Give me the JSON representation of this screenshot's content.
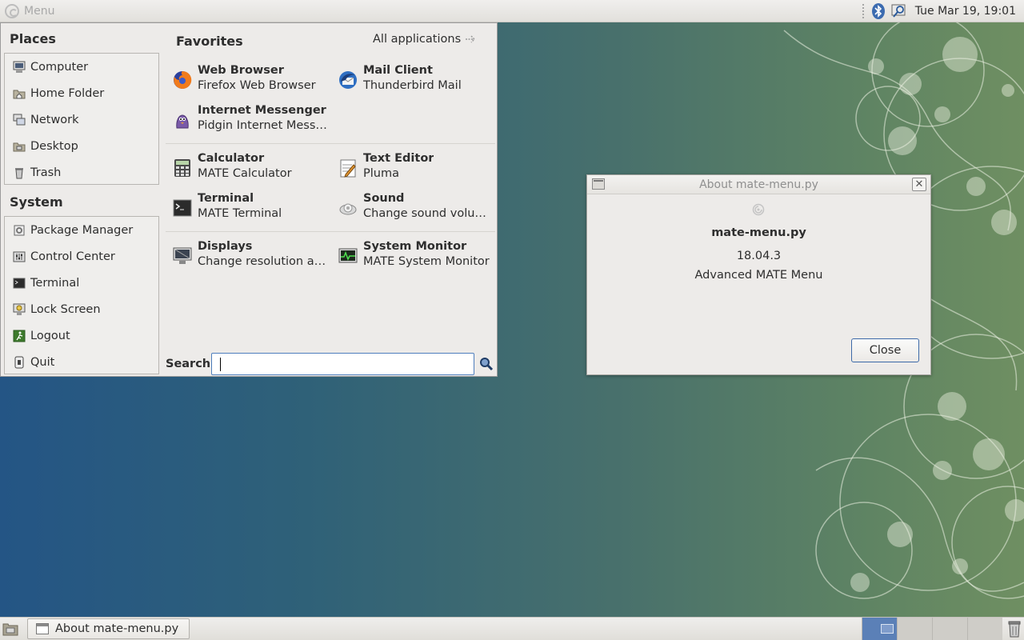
{
  "top_panel": {
    "menu_label": "Menu",
    "clock": "Tue Mar 19, 19:01"
  },
  "menu": {
    "places_heading": "Places",
    "places": [
      {
        "label": "Computer",
        "icon": "computer-icon"
      },
      {
        "label": "Home Folder",
        "icon": "home-folder-icon"
      },
      {
        "label": "Network",
        "icon": "network-icon"
      },
      {
        "label": "Desktop",
        "icon": "desktop-folder-icon"
      },
      {
        "label": "Trash",
        "icon": "trash-icon"
      }
    ],
    "system_heading": "System",
    "system": [
      {
        "label": "Package Manager",
        "icon": "package-manager-icon"
      },
      {
        "label": "Control Center",
        "icon": "control-center-icon"
      },
      {
        "label": "Terminal",
        "icon": "terminal-icon"
      },
      {
        "label": "Lock Screen",
        "icon": "lock-screen-icon"
      },
      {
        "label": "Logout",
        "icon": "logout-icon"
      },
      {
        "label": "Quit",
        "icon": "quit-icon"
      }
    ],
    "favorites_heading": "Favorites",
    "all_applications": "All applications",
    "favorites": [
      {
        "name": "Web Browser",
        "desc": "Firefox Web Browser",
        "icon": "firefox-icon"
      },
      {
        "name": "Mail Client",
        "desc": "Thunderbird Mail",
        "icon": "thunderbird-icon"
      },
      {
        "name": "Internet Messenger",
        "desc": "Pidgin Internet Messe…",
        "icon": "pidgin-icon"
      },
      {
        "name": "Calculator",
        "desc": "MATE Calculator",
        "icon": "calculator-icon"
      },
      {
        "name": "Text Editor",
        "desc": "Pluma",
        "icon": "text-editor-icon"
      },
      {
        "name": "Terminal",
        "desc": "MATE Terminal",
        "icon": "terminal-icon"
      },
      {
        "name": "Sound",
        "desc": "Change sound volume…",
        "icon": "sound-icon"
      },
      {
        "name": "Displays",
        "desc": "Change resolution an…",
        "icon": "displays-icon"
      },
      {
        "name": "System Monitor",
        "desc": "MATE System Monitor",
        "icon": "system-monitor-icon"
      }
    ],
    "search_label": "Search:",
    "search_value": ""
  },
  "dialog": {
    "title": "About mate-menu.py",
    "name": "mate-menu.py",
    "version": "18.04.3",
    "comment": "Advanced MATE Menu",
    "close_label": "Close"
  },
  "bottom_panel": {
    "task_label": "About mate-menu.py"
  },
  "colors": {
    "accent": "#4f7fbd",
    "active_workspace": "#5b80b7"
  }
}
